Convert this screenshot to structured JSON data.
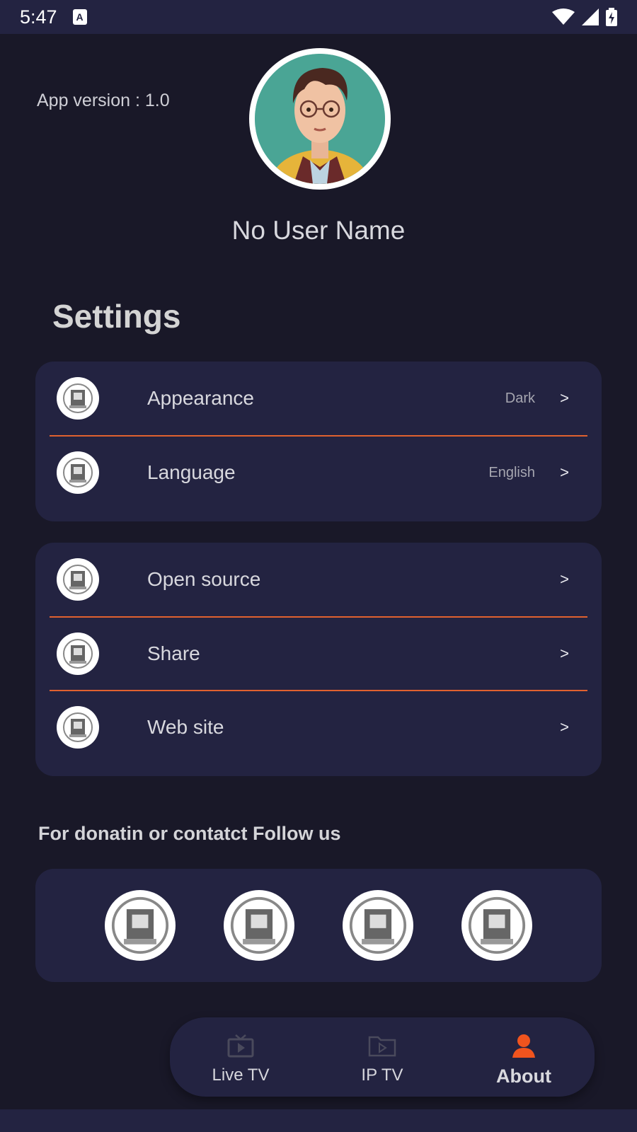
{
  "status_bar": {
    "time": "5:47",
    "notif_letter": "A"
  },
  "profile": {
    "app_version": "App version : 1.0",
    "username": "No User Name"
  },
  "settings": {
    "title": "Settings",
    "group1": [
      {
        "label": "Appearance",
        "value": "Dark",
        "chevron": ">"
      },
      {
        "label": "Language",
        "value": "English",
        "chevron": ">"
      }
    ],
    "group2": [
      {
        "label": "Open source",
        "chevron": ">"
      },
      {
        "label": "Share",
        "chevron": ">"
      },
      {
        "label": "Web site",
        "chevron": ">"
      }
    ]
  },
  "follow": {
    "title": "For donatin or contatct Follow us"
  },
  "bottom_nav": {
    "items": [
      {
        "label": "Live TV",
        "icon": "tv-icon"
      },
      {
        "label": "IP TV",
        "icon": "video-folder-icon"
      },
      {
        "label": "About",
        "icon": "person-icon"
      }
    ],
    "active": "About"
  },
  "colors": {
    "background": "#191828",
    "card": "#232341",
    "divider": "#e0612f",
    "accent": "#f0541e"
  }
}
